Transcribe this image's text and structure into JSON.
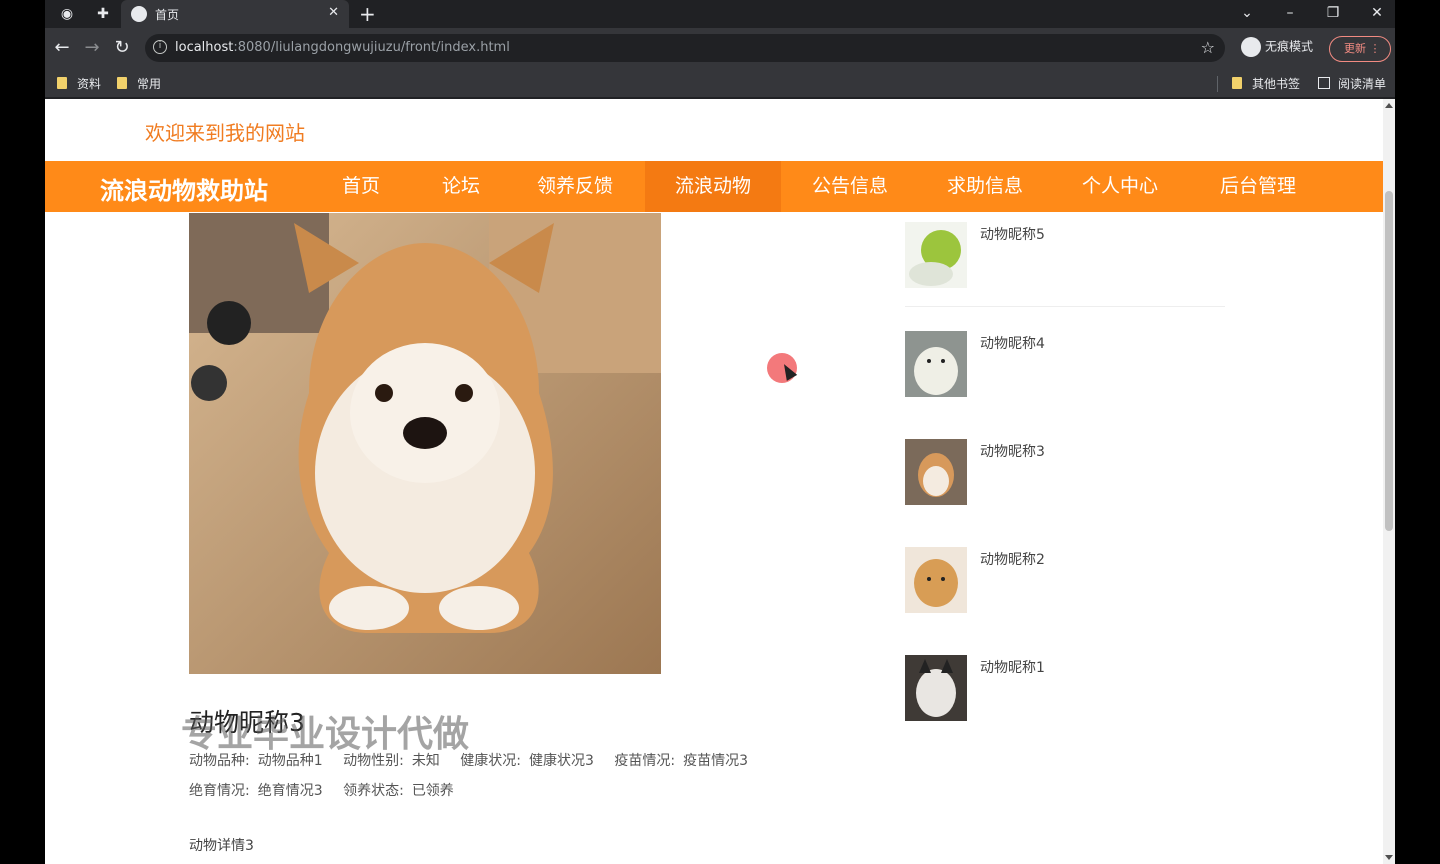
{
  "browser": {
    "tab_title": "首页",
    "url_host": "localhost",
    "url_rest": ":8080/liulangdongwujiuzu/front/index.html",
    "profile_label": "无痕模式",
    "update_label": "更新",
    "bookmarks": [
      {
        "label": "资料"
      },
      {
        "label": "常用"
      }
    ],
    "other_bookmarks": "其他书签",
    "reading_list": "阅读清单"
  },
  "site": {
    "welcome": "欢迎来到我的网站",
    "brand": "流浪动物救助站",
    "nav": [
      {
        "label": "首页",
        "active": false
      },
      {
        "label": "论坛",
        "active": false
      },
      {
        "label": "领养反馈",
        "active": false
      },
      {
        "label": "流浪动物",
        "active": true
      },
      {
        "label": "公告信息",
        "active": false
      },
      {
        "label": "求助信息",
        "active": false
      },
      {
        "label": "个人中心",
        "active": false
      },
      {
        "label": "后台管理",
        "active": false
      }
    ],
    "accent_color": "#ff8a18"
  },
  "detail": {
    "name": "动物昵称3",
    "watermark": "专业毕业设计代做",
    "row1": [
      {
        "label": "动物品种:",
        "value": "动物品种1"
      },
      {
        "label": "动物性别:",
        "value": "未知"
      },
      {
        "label": "健康状况:",
        "value": "健康状况3"
      },
      {
        "label": "疫苗情况:",
        "value": "疫苗情况3"
      }
    ],
    "row2": [
      {
        "label": "绝育情况:",
        "value": "绝育情况3"
      },
      {
        "label": "领养状态:",
        "value": "已领养"
      }
    ],
    "description": "动物详情3"
  },
  "sidebar": {
    "items": [
      {
        "name": "动物昵称5",
        "thumb": "green-bird"
      },
      {
        "name": "动物昵称4",
        "thumb": "white-bear"
      },
      {
        "name": "动物昵称3",
        "thumb": "shiba"
      },
      {
        "name": "动物昵称2",
        "thumb": "puppy"
      },
      {
        "name": "动物昵称1",
        "thumb": "cat"
      }
    ]
  }
}
